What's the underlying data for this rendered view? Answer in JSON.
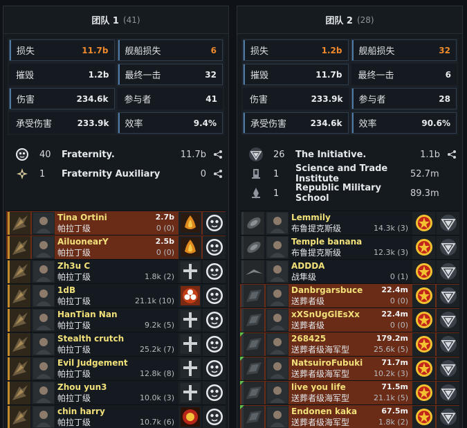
{
  "teams": [
    {
      "name": "团队 1",
      "count": "(41)",
      "stats": {
        "loss": {
          "label": "损失",
          "value": "11.7b"
        },
        "ship_loss": {
          "label": "舰船损失",
          "value": "6"
        },
        "destroyed": {
          "label": "摧毁",
          "value": "1.2b"
        },
        "final_blow": {
          "label": "最终一击",
          "value": "32"
        },
        "damage": {
          "label": "伤害",
          "value": "234.6k"
        },
        "participants": {
          "label": "参与者",
          "value": "41"
        },
        "damage_taken": {
          "label": "承受伤害",
          "value": "233.9k"
        },
        "efficiency": {
          "label": "效率",
          "value": "9.4%"
        }
      },
      "alliances": [
        {
          "count": "40",
          "name": "Fraternity.",
          "value": "11.7b",
          "icon": "fraternity-logo"
        },
        {
          "count": "1",
          "name": "Fraternity Auxiliary",
          "value": "0",
          "icon": "auxiliary-logo"
        }
      ],
      "pilots": [
        {
          "name": "Tina Ortini",
          "damage": "2.7b",
          "ship": "帕拉丁级",
          "dmg_detail": "0 (0)",
          "killed": true
        },
        {
          "name": "AiluonearY",
          "damage": "2.5b",
          "ship": "帕拉丁级",
          "dmg_detail": "0 (0)",
          "killed": true
        },
        {
          "name": "Zh3u C",
          "damage": "",
          "ship": "帕拉丁级",
          "dmg_detail": "1.8k (2)",
          "killed": false
        },
        {
          "name": "1dB",
          "damage": "",
          "ship": "帕拉丁级",
          "dmg_detail": "21.1k (10)",
          "killed": false
        },
        {
          "name": "HanTian Nan",
          "damage": "",
          "ship": "帕拉丁级",
          "dmg_detail": "9.2k (5)",
          "killed": false
        },
        {
          "name": "Stealth crutch",
          "damage": "",
          "ship": "帕拉丁级",
          "dmg_detail": "25.2k (7)",
          "killed": false
        },
        {
          "name": "Evil Judgement",
          "damage": "",
          "ship": "帕拉丁级",
          "dmg_detail": "12.8k (8)",
          "killed": false
        },
        {
          "name": "Zhou yun3",
          "damage": "",
          "ship": "帕拉丁级",
          "dmg_detail": "10.0k (3)",
          "killed": false
        },
        {
          "name": "chin harry",
          "damage": "",
          "ship": "帕拉丁级",
          "dmg_detail": "10.7k (6)",
          "killed": false
        }
      ]
    },
    {
      "name": "团队 2",
      "count": "(28)",
      "stats": {
        "loss": {
          "label": "损失",
          "value": "1.2b"
        },
        "ship_loss": {
          "label": "舰船损失",
          "value": "32"
        },
        "destroyed": {
          "label": "摧毁",
          "value": "11.7b"
        },
        "final_blow": {
          "label": "最终一击",
          "value": "6"
        },
        "damage": {
          "label": "伤害",
          "value": "233.9k"
        },
        "participants": {
          "label": "参与者",
          "value": "28"
        },
        "damage_taken": {
          "label": "承受伤害",
          "value": "234.6k"
        },
        "efficiency": {
          "label": "效率",
          "value": "90.6%"
        }
      },
      "alliances": [
        {
          "count": "26",
          "name": "The Initiative.",
          "value": "1.1b",
          "icon": "initiative-logo"
        },
        {
          "count": "1",
          "name": "Science and Trade Institute",
          "value": "52.7m",
          "icon": "sti-logo"
        },
        {
          "count": "1",
          "name": "Republic Military School",
          "value": "89.3m",
          "icon": "rms-logo"
        }
      ],
      "pilots": [
        {
          "name": "Lemmily",
          "damage": "",
          "ship": "布鲁提克斯级",
          "dmg_detail": "14.3k (3)",
          "killed": false
        },
        {
          "name": "Temple banana",
          "damage": "",
          "ship": "布鲁提克斯级",
          "dmg_detail": "12.3k (3)",
          "killed": false
        },
        {
          "name": "ADDDA",
          "damage": "",
          "ship": "战隼级",
          "dmg_detail": "0 (1)",
          "killed": false
        },
        {
          "name": "Danbrgarsbuce",
          "damage": "22.4m",
          "ship": "送葬者级",
          "dmg_detail": "0 (0)",
          "killed": true
        },
        {
          "name": "xXSnUgGlEsXx",
          "damage": "22.4m",
          "ship": "送葬者级",
          "dmg_detail": "0 (0)",
          "killed": true
        },
        {
          "name": "268425",
          "damage": "179.2m",
          "ship": "送葬者级海军型",
          "dmg_detail": "25.6k (5)",
          "killed": true
        },
        {
          "name": "NatsuiroFubuki",
          "damage": "71.7m",
          "ship": "送葬者级海军型",
          "dmg_detail": "10.2k (3)",
          "killed": true
        },
        {
          "name": "live you life",
          "damage": "71.5m",
          "ship": "送葬者级海军型",
          "dmg_detail": "21.1k (5)",
          "killed": true
        },
        {
          "name": "Endonen kaka",
          "damage": "67.5m",
          "ship": "送葬者级海军型",
          "dmg_detail": "1.8k (2)",
          "killed": true
        }
      ]
    }
  ],
  "colors": {
    "accent_orange": "#f08a2c",
    "pilot_name": "#f1e07a",
    "killed_row": "#6a2c17"
  }
}
